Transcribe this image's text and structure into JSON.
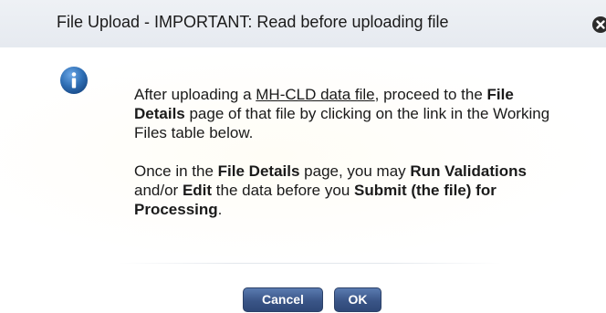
{
  "dialog": {
    "title": "File Upload - IMPORTANT: Read before uploading file",
    "close_icon": "close-icon",
    "info_icon": "info-icon",
    "message": {
      "p1": {
        "t1": "After uploading a ",
        "link": "MH-CLD data file",
        "t2": ", proceed to the ",
        "b1": "File Details",
        "t3": " page of that file by clicking on the link in the Working Files table below."
      },
      "p2": {
        "t1": "Once in the ",
        "b1": "File Details",
        "t2": " page, you may ",
        "b2": "Run Validations",
        "t3": " and/or ",
        "b3": "Edit",
        "t4": " the data before you ",
        "b4": "Submit (the file) for Processing",
        "t5": "."
      }
    },
    "buttons": {
      "cancel": "Cancel",
      "ok": "OK"
    },
    "colors": {
      "button": "#3a5587",
      "info_icon": "#2f6fb5",
      "title_bar": "#e9edf2"
    }
  }
}
